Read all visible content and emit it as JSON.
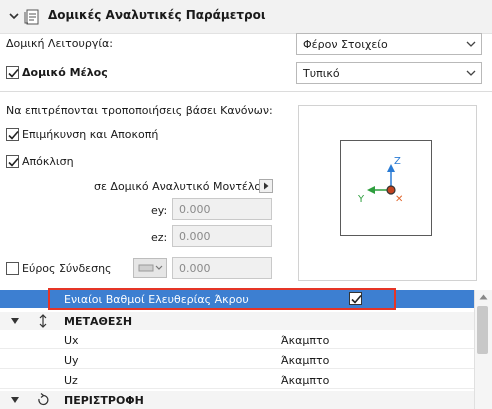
{
  "header": {
    "title": "Δομικές Αναλυτικές Παράμετροι",
    "icon": "structural-analytics-icon"
  },
  "function": {
    "label": "Δομική Λειτουργία:",
    "value": "Φέρον Στοιχείο"
  },
  "member": {
    "label": "Δομικό Μέλος",
    "checked": true,
    "value": "Τυπικό"
  },
  "rules": {
    "heading": "Να επιτρέπονται τροποποιήσεις βάσει Κανόνων:",
    "extend_trim": {
      "label": "Επιμήκυνση και Αποκοπή",
      "checked": true
    },
    "offset": {
      "label": "Απόκλιση",
      "checked": true
    },
    "model_label": "σε Δομικό Αναλυτικό Μοντέλο",
    "ey": {
      "label": "ey:",
      "value": "0.000"
    },
    "ez": {
      "label": "ez:",
      "value": "0.000"
    },
    "connection": {
      "label": "Εύρος Σύνδεσης",
      "checked": false,
      "value": "0.000"
    }
  },
  "preview": {
    "axis_z": "Z",
    "axis_y": "Y",
    "axis_x": "✕",
    "colors": {
      "z": "#2a7bd4",
      "y": "#2e9e3e",
      "x": "#e0642a"
    }
  },
  "table": {
    "highlight_row": {
      "label": "Ενιαίοι Βαθμοί Ελευθερίας Άκρου",
      "checked": true
    },
    "groups": [
      {
        "name": "ΜΕΤΑΘΕΣΗ",
        "rows": [
          {
            "name": "Ux",
            "value": "Άκαμπτο"
          },
          {
            "name": "Uy",
            "value": "Άκαμπτο"
          },
          {
            "name": "Uz",
            "value": "Άκαμπτο"
          }
        ]
      },
      {
        "name": "ΠΕΡΙΣΤΡΟΦΗ",
        "rows": []
      }
    ]
  }
}
